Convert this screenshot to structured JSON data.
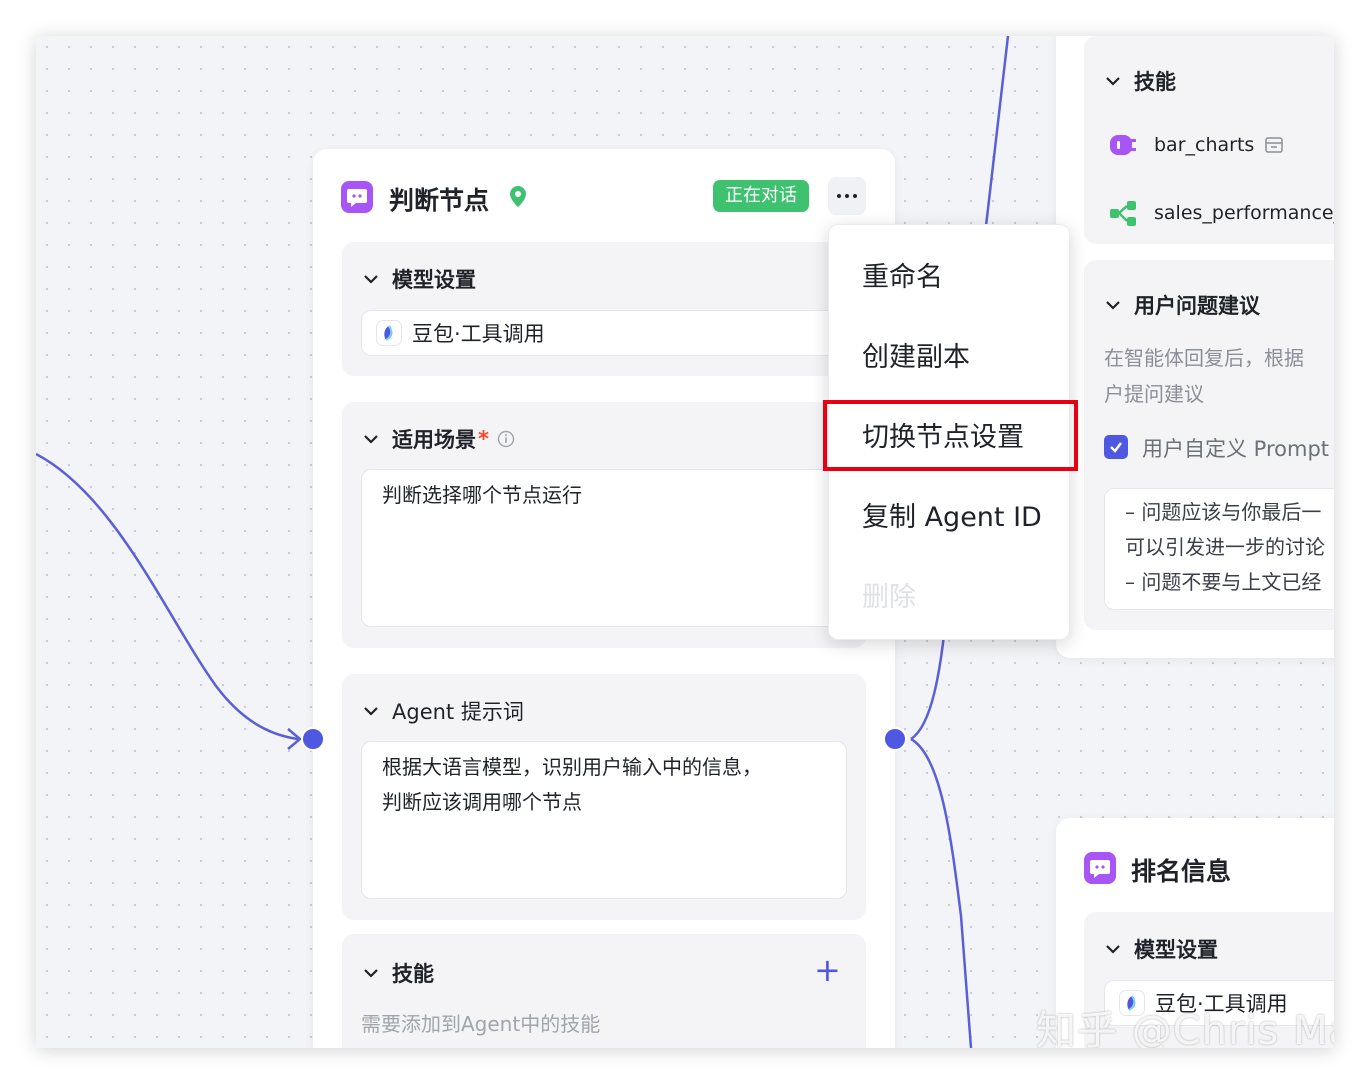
{
  "judge_node": {
    "title": "判断节点",
    "status_badge": "正在对话",
    "model_section": {
      "heading": "模型设置",
      "model_name": "豆包·工具调用"
    },
    "scene_section": {
      "heading": "适用场景",
      "required_mark": "*",
      "value": "判断选择哪个节点运行"
    },
    "prompt_section": {
      "heading": "Agent 提示词",
      "line1": "根据大语言模型，识别用户输入中的信息，",
      "line2": "判断应该调用哪个节点"
    },
    "skills_section": {
      "heading": "技能",
      "add_symbol": "+",
      "hint": "需要添加到Agent中的技能"
    }
  },
  "context_menu": {
    "items": [
      "重命名",
      "创建副本",
      "切换节点设置",
      "复制 Agent ID",
      "删除"
    ],
    "highlighted_item": "切换节点设置",
    "highlight_color": "#e60012"
  },
  "right_top_node": {
    "skills_heading": "技能",
    "skills": [
      "bar_charts",
      "sales_performance_"
    ],
    "suggestion_section": {
      "heading": "用户问题建议",
      "desc_line1": "在智能体回复后，根据",
      "desc_line2": "户提问建议",
      "checkbox_label": "用户自定义 Prompt",
      "prompt_line1": "– 问题应该与你最后一",
      "prompt_line2": "可以引发进一步的讨论",
      "prompt_line3": "– 问题不要与上文已经"
    }
  },
  "rank_node": {
    "title": "排名信息",
    "model_heading": "模型设置",
    "model_name": "豆包·工具调用"
  },
  "watermark": "知乎 @Chris Ma",
  "colors": {
    "accent": "#4f58e0",
    "badge_green": "#3fc270",
    "bot_purple": "#a855f7",
    "skill_green": "#3fc270",
    "location_green": "#3fc270"
  }
}
